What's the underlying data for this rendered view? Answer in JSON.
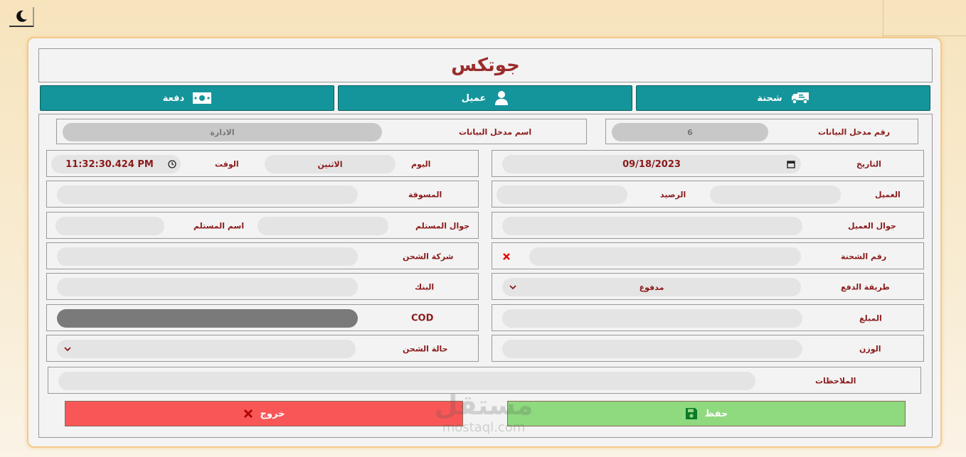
{
  "theme_toggle": {
    "icon": "moon-icon"
  },
  "header": {
    "title": "جوتكس"
  },
  "tabs": [
    {
      "label": "شحنة",
      "icon": "truck-icon"
    },
    {
      "label": "عميل",
      "icon": "user-icon"
    },
    {
      "label": "دفعة",
      "icon": "money-bill-icon"
    }
  ],
  "form": {
    "entry_number_label": "رقم مدخل البيانات",
    "entry_number_value": "6",
    "entry_name_label": "اسم مدخل البيانات",
    "entry_name_value": "الادارة",
    "date_label": "التاريخ",
    "date_value": "09/18/2023",
    "day_label": "اليوم",
    "day_value": "الاثنين",
    "time_label": "الوقت",
    "time_value": "11:32:30.424 PM",
    "client_label": "العميل",
    "balance_label": "الرصيد",
    "marketer_label": "المسوقة",
    "client_phone_label": "جوال العميل",
    "receiver_phone_label": "جوال المستلم",
    "receiver_name_label": "اسم المستلم",
    "shipment_number_label": "رقم الشحنة",
    "shipping_company_label": "شركة الشحن",
    "payment_method_label": "طريقة الدفع",
    "payment_method_value": "مدفوع",
    "bank_label": "البنك",
    "amount_label": "المبلغ",
    "cod_label": "COD",
    "weight_label": "الوزن",
    "shipping_status_label": "حالة الشحن",
    "notes_label": "الملاحظات"
  },
  "actions": {
    "save_label": "حفظ",
    "exit_label": "خروج"
  },
  "watermark": {
    "arabic": "مستقل",
    "latin": "mostaql.com"
  },
  "colors": {
    "teal": "#14959b",
    "label_red": "#8b1a1a",
    "save_green": "#8fd97f",
    "exit_red": "#f95757"
  }
}
